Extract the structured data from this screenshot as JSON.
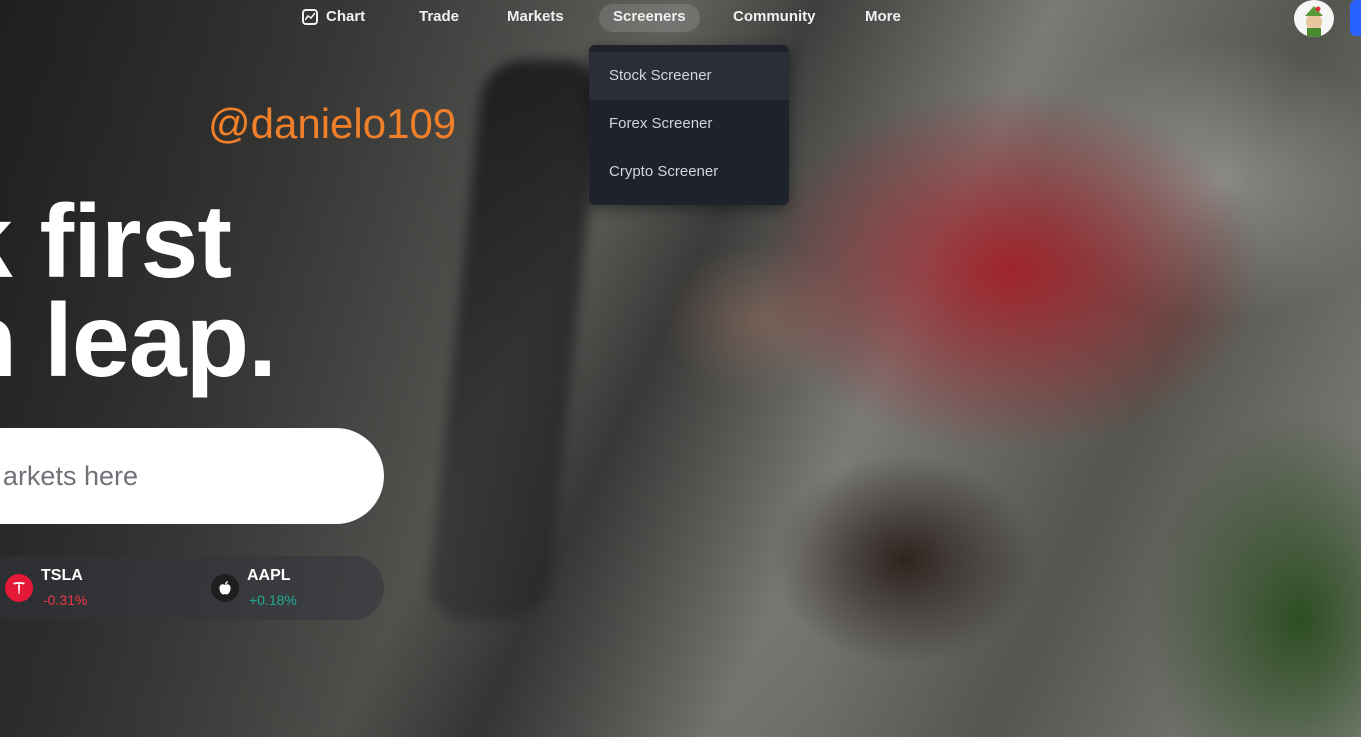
{
  "nav": {
    "items": [
      {
        "label": "Chart",
        "icon": "chart-icon"
      },
      {
        "label": "Trade"
      },
      {
        "label": "Markets"
      },
      {
        "label": "Screeners",
        "active": true
      },
      {
        "label": "Community"
      },
      {
        "label": "More"
      }
    ]
  },
  "dropdown": {
    "items": [
      "Stock Screener",
      "Forex Screener",
      "Crypto Screener"
    ]
  },
  "watermark": "@danielo109",
  "hero": {
    "line1": "k first",
    "line2": "n leap.",
    "search_placeholder": "arkets here"
  },
  "tickers": [
    {
      "symbol": "TSLA",
      "change": "-0.31%",
      "color": "#f23645",
      "logo_color": "#e31937",
      "logo": "T"
    },
    {
      "symbol": "AAPL",
      "change": "+0.18%",
      "color": "#22ab94",
      "logo_color": "#1e1e1e",
      "logo": ""
    }
  ],
  "colors": {
    "accent": "#2962ff",
    "menu_bg": "#1e222d",
    "watermark": "#f07f2a"
  }
}
